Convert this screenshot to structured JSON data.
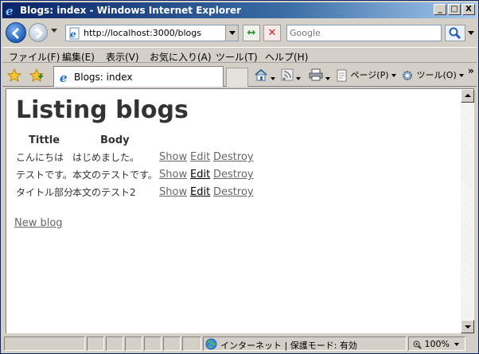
{
  "window": {
    "title": "Blogs: index - Windows Internet Explorer",
    "min_label": "_",
    "max_label": "□",
    "close_label": "X"
  },
  "nav": {
    "url": "http://localhost:3000/blogs",
    "search_placeholder": "Google",
    "refresh_glyph": "↔",
    "stop_glyph": "✕"
  },
  "menu": {
    "items": [
      "ファイル(F)",
      "編集(E)",
      "表示(V)",
      "お気に入り(A)",
      "ツール(T)",
      "ヘルプ(H)"
    ]
  },
  "tabs": {
    "active_tab": "Blogs: index"
  },
  "commands": {
    "page": "ページ(P)",
    "tools": "ツール(O)",
    "chevron": "»"
  },
  "page": {
    "heading": "Listing blogs",
    "columns": [
      "Tittle",
      "Body"
    ],
    "rows": [
      {
        "title": "こんにちは",
        "body": "はじめました。"
      },
      {
        "title": "テストです。",
        "body": "本文のテストです。"
      },
      {
        "title": "タイトル部分",
        "body": "本文のテスト2"
      }
    ],
    "actions": {
      "show": "Show",
      "edit": "Edit",
      "destroy": "Destroy"
    },
    "new_link": "New blog"
  },
  "status": {
    "zone": "インターネット | 保護モード: 有効",
    "zoom": "100%"
  },
  "colors": {
    "title_bar": "#0a246a",
    "link": "#666666",
    "link_visited": "#000000"
  }
}
